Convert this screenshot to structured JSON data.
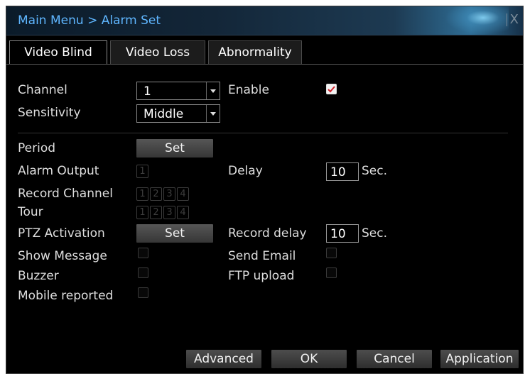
{
  "window": {
    "title": "Main Menu > Alarm Set",
    "close_glyph": "X"
  },
  "tabs": [
    {
      "label": "Video Blind",
      "active": true
    },
    {
      "label": "Video Loss",
      "active": false
    },
    {
      "label": "Abnormality",
      "active": false
    }
  ],
  "channel": {
    "label": "Channel",
    "value": "1"
  },
  "enable": {
    "label": "Enable",
    "checked": true
  },
  "sensitivity": {
    "label": "Sensitivity",
    "value": "Middle"
  },
  "period": {
    "label": "Period",
    "button": "Set"
  },
  "alarm_output": {
    "label": "Alarm Output",
    "channels": [
      "1"
    ]
  },
  "delay": {
    "label": "Delay",
    "value": "10",
    "unit": "Sec."
  },
  "record_channel": {
    "label": "Record Channel",
    "channels": [
      "1",
      "2",
      "3",
      "4"
    ]
  },
  "tour": {
    "label": "Tour",
    "channels": [
      "1",
      "2",
      "3",
      "4"
    ]
  },
  "ptz": {
    "label": "PTZ Activation",
    "button": "Set"
  },
  "record_delay": {
    "label": "Record delay",
    "value": "10",
    "unit": "Sec."
  },
  "show_message": {
    "label": "Show Message",
    "checked": false
  },
  "send_email": {
    "label": "Send Email",
    "checked": false
  },
  "buzzer": {
    "label": "Buzzer",
    "checked": false
  },
  "ftp_upload": {
    "label": "FTP upload",
    "checked": false
  },
  "mobile_reported": {
    "label": "Mobile reported",
    "checked": false
  },
  "buttons": {
    "advanced": "Advanced",
    "ok": "OK",
    "cancel": "Cancel",
    "application": "Application"
  },
  "colors": {
    "title": "#5fb6ff",
    "background": "#000000",
    "check": "#d0202a"
  }
}
